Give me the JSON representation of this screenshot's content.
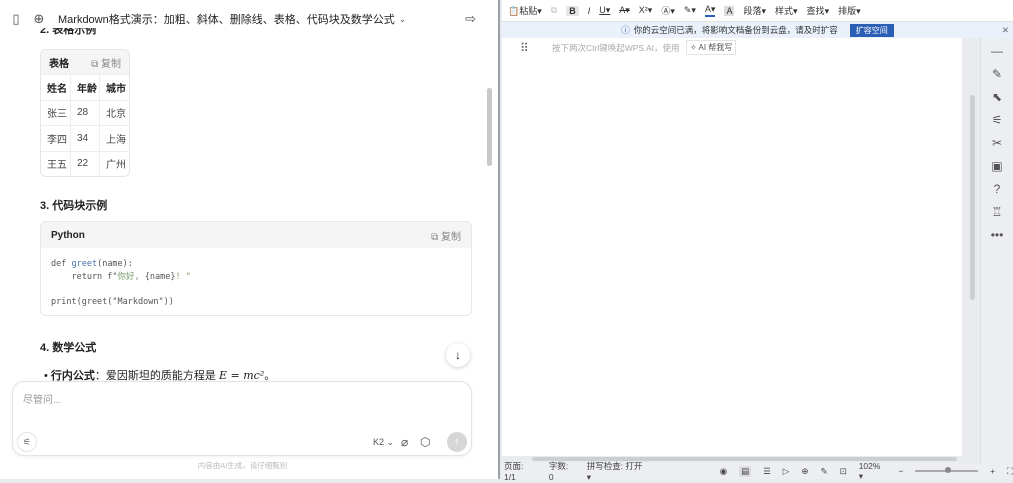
{
  "chat": {
    "title": "Markdown格式演示：加粗、斜体、删除线、表格、代码块及数学公式",
    "section2_partial": "2. 表格示例",
    "table": {
      "label": "表格",
      "copy": "复制",
      "headers": [
        "姓名",
        "年龄",
        "城市"
      ],
      "rows": [
        [
          "张三",
          "28",
          "北京"
        ],
        [
          "李四",
          "34",
          "上海"
        ],
        [
          "王五",
          "22",
          "广州"
        ]
      ]
    },
    "section3": "3. 代码块示例",
    "code": {
      "lang": "Python",
      "copy": "复制",
      "line1a": "def ",
      "line1b": "greet",
      "line1c": "(name):",
      "line2a": "    return f\"",
      "line2b": "你好, ",
      "line2c": "{name}",
      "line2d": "! \"",
      "line4": "print(greet(\"Markdown\"))"
    },
    "section4": "4. 数学公式",
    "bullet_label": "行内公式",
    "bullet_text": "：爱因斯坦的质能方程是 ",
    "formula": "E = mc²",
    "formula_end": "。",
    "input_placeholder": "尽管问...",
    "model": "K2",
    "disclaimer": "内容由AI生成，请仔细甄别"
  },
  "wps": {
    "toolbar": [
      "粘贴",
      "段落",
      "样式",
      "查找",
      "排版"
    ],
    "banner": "你的云空间已满，将影响文档备份到云盘，请及时扩容",
    "banner_button": "扩容空间",
    "doc_hint": "按下两次Ctrl键唤起WPS AI，使用",
    "ai_button": "AI 帮我写",
    "status": {
      "page": "页面: 1/1",
      "words": "字数: 0",
      "spell": "拼写检查: 打开",
      "zoom": "102%"
    },
    "zoom_level_percent": 102
  }
}
